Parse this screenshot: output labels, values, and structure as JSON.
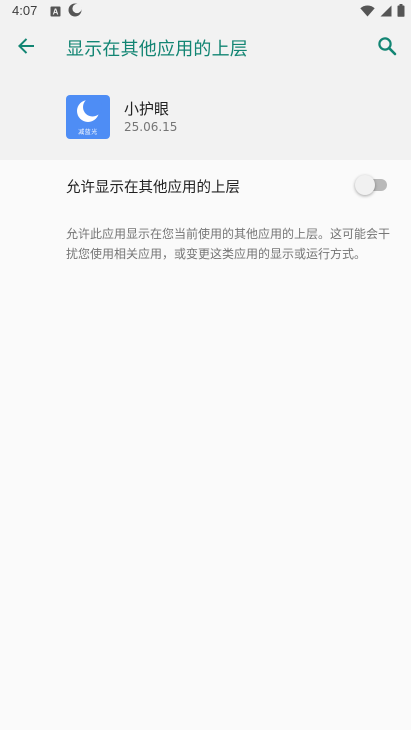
{
  "status_bar": {
    "time": "4:07",
    "left_icons": [
      "keyboard-a-icon",
      "moon-icon"
    ],
    "right_icons": [
      "wifi-icon",
      "cellular-signal-icon",
      "battery-icon"
    ]
  },
  "app_bar": {
    "back_icon": "arrow-back-icon",
    "title": "显示在其他应用的上层",
    "search_icon": "search-icon",
    "accent_color": "#128573"
  },
  "app_info": {
    "icon_caption": "减蓝光",
    "icon_color": "#4e8df5",
    "name": "小护眼",
    "version": "25.06.15"
  },
  "setting": {
    "label": "允许显示在其他应用的上层",
    "toggle_state": "off"
  },
  "description": "允许此应用显示在您当前使用的其他应用的上层。这可能会干扰您使用相关应用，或变更这类应用的显示或运行方式。"
}
